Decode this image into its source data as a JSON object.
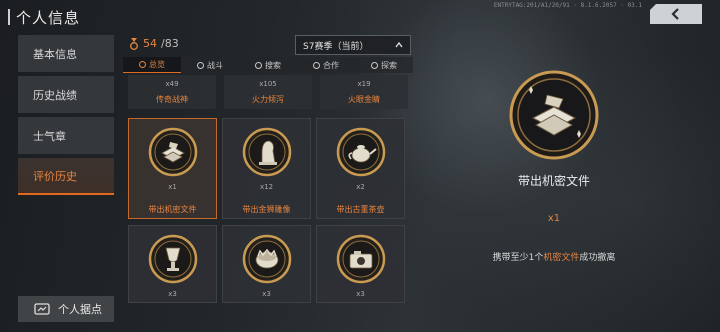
{
  "header": {
    "title": "个人信息",
    "version": "ENTRYTAG:201/A1/20/91 · 8.1.6.2057 · 03.1"
  },
  "nav": {
    "items": [
      {
        "label": "基本信息"
      },
      {
        "label": "历史战绩"
      },
      {
        "label": "士气章"
      },
      {
        "label": "评价历史",
        "active": true
      }
    ],
    "home_label": "个人据点"
  },
  "collection": {
    "current": "54",
    "total": "/83"
  },
  "season_select": {
    "value": "S7赛季（当前）"
  },
  "tabs": [
    {
      "label": "总览",
      "active": true
    },
    {
      "label": "战斗"
    },
    {
      "label": "搜索"
    },
    {
      "label": "合作"
    },
    {
      "label": "探索"
    }
  ],
  "partial_row": [
    {
      "qty": "x49",
      "name": "传奇战神"
    },
    {
      "qty": "x105",
      "name": "火力倾泻"
    },
    {
      "qty": "x19",
      "name": "火眼金睛"
    }
  ],
  "grid": [
    {
      "qty": "x1",
      "name": "带出机密文件",
      "icon": "secret-files-icon",
      "active": true
    },
    {
      "qty": "x12",
      "name": "带出金狮雕像",
      "icon": "golden-lion-icon"
    },
    {
      "qty": "x2",
      "name": "带出古董茶壶",
      "icon": "antique-teapot-icon"
    },
    {
      "qty": "x3",
      "name": "",
      "icon": "trophy-vase-icon"
    },
    {
      "qty": "x3",
      "name": "",
      "icon": "crown-bowl-icon"
    },
    {
      "qty": "x3",
      "name": "",
      "icon": "camera-icon"
    }
  ],
  "detail": {
    "name": "带出机密文件",
    "qty": "x1",
    "desc_prefix": "携带至少1个",
    "desc_highlight": "机密文件",
    "desc_suffix": "成功撤离"
  },
  "colors": {
    "accent": "#e8843e",
    "gold": "#c99a52",
    "panel": "#2d3034"
  }
}
